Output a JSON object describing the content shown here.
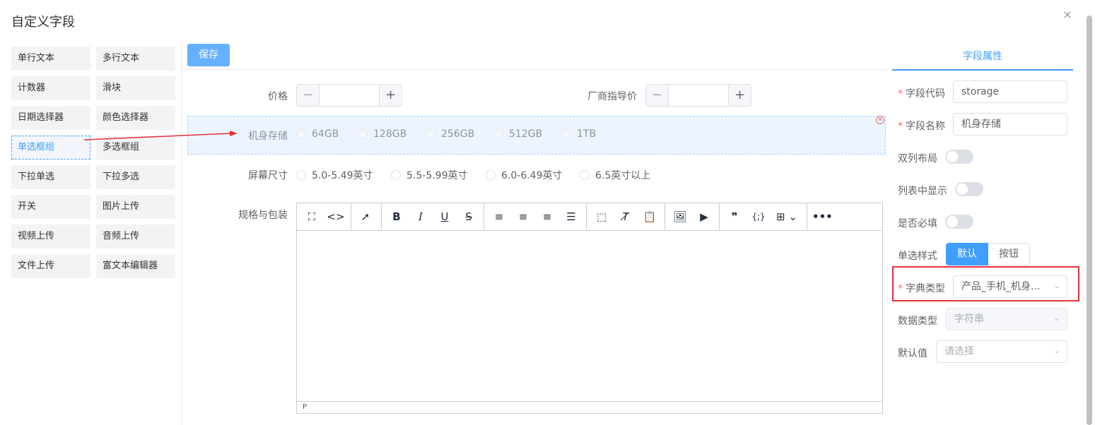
{
  "dialog": {
    "title": "自定义字段",
    "close_glyph": "×"
  },
  "palette": {
    "items": [
      {
        "label": "单行文本"
      },
      {
        "label": "多行文本"
      },
      {
        "label": "计数器"
      },
      {
        "label": "滑块"
      },
      {
        "label": "日期选择器"
      },
      {
        "label": "颜色选择器"
      },
      {
        "label": "单选框组"
      },
      {
        "label": "多选框组"
      },
      {
        "label": "下拉单选"
      },
      {
        "label": "下拉多选"
      },
      {
        "label": "开关"
      },
      {
        "label": "图片上传"
      },
      {
        "label": "视频上传"
      },
      {
        "label": "音频上传"
      },
      {
        "label": "文件上传"
      },
      {
        "label": "富文本编辑器"
      }
    ],
    "active_item": "单选框组"
  },
  "canvas": {
    "save_label": "保存",
    "price_label": "价格",
    "msrp_label": "厂商指导价",
    "stepper_minus": "−",
    "stepper_plus": "+",
    "storage": {
      "label": "机身存储",
      "options": [
        "64GB",
        "128GB",
        "256GB",
        "512GB",
        "1TB"
      ]
    },
    "screen": {
      "label": "屏幕尺寸",
      "options": [
        "5.0-5.49英寸",
        "5.5-5.99英寸",
        "6.0-6.49英寸",
        "6.5英寸以上"
      ]
    },
    "spec_label": "规格与包装",
    "editor_status": "P"
  },
  "editor_toolbar": {
    "icons": [
      "fullscreen-icon",
      "code-icon",
      "select-icon",
      "bold-icon",
      "italic-icon",
      "underline-icon",
      "strikethrough-icon",
      "align-left-icon",
      "align-center-icon",
      "align-right-icon",
      "align-justify-icon",
      "select-all-icon",
      "clear-format-icon",
      "paste-text-icon",
      "image-icon",
      "media-icon",
      "blockquote-icon",
      "code-sample-icon",
      "table-icon",
      "more-icon"
    ]
  },
  "panel": {
    "tab_label": "字段属性",
    "field_code_label": "字段代码",
    "field_code_value": "storage",
    "field_name_label": "字段名称",
    "field_name_value": "机身存储",
    "double_column_label": "双列布局",
    "show_in_list_label": "列表中显示",
    "required_label": "是否必填",
    "radio_style_label": "单选样式",
    "radio_style_default": "默认",
    "radio_style_button": "按钮",
    "dict_type_label": "字典类型",
    "dict_type_value": "产品_手机_机身...",
    "data_type_label": "数据类型",
    "data_type_value": "字符串",
    "default_label": "默认值",
    "default_placeholder": "请选择"
  },
  "colors": {
    "accent": "#409eff",
    "annotation_red": "#e5303a"
  }
}
